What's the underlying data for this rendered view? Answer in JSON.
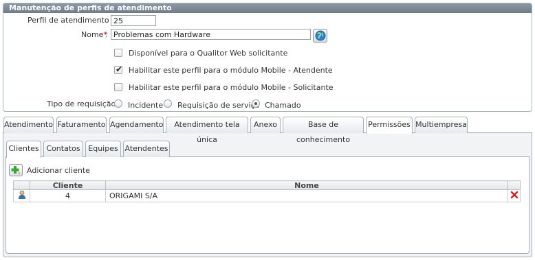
{
  "panel": {
    "title": "Manutenção de perfis de atendimento",
    "perfil_label": "Perfil de atendimento :",
    "perfil_value": "25",
    "nome_label": "Nome",
    "nome_required": "*",
    "nome_colon": ":",
    "nome_value": "Problemas com Hardware",
    "checkboxes": [
      {
        "label": "Disponível para o Qualitor Web solicitante",
        "checked": false
      },
      {
        "label": "Habilitar este perfil para o módulo Mobile - Atendente",
        "checked": true
      },
      {
        "label": "Habilitar este perfil para o módulo Mobile - Solicitante",
        "checked": false
      }
    ],
    "tipo_label": "Tipo de requisição :",
    "radios": [
      {
        "label": "Incidente",
        "selected": false
      },
      {
        "label": "Requisição de serviço",
        "selected": false
      },
      {
        "label": "Chamado",
        "selected": true
      }
    ]
  },
  "tabs": [
    "Atendimento",
    "Faturamento",
    "Agendamento",
    "Atendimento tela única",
    "Anexo",
    "Base de conhecimento",
    "Permissões",
    "Multiempresa"
  ],
  "active_tab": "Permissões",
  "subtabs": [
    "Clientes",
    "Contatos",
    "Equipes",
    "Atendentes"
  ],
  "active_subtab": "Clientes",
  "add_client_label": "Adicionar cliente",
  "table": {
    "headers": [
      "Cliente",
      "Nome"
    ],
    "rows": [
      {
        "cliente": "4",
        "nome": "ORIGAMI S/A"
      }
    ]
  },
  "colors": {
    "header_bg": "#7a8793",
    "delete_red": "#e02020",
    "globe_blue": "#2f7fd0",
    "add_green": "#3aa832"
  },
  "icons": {
    "globe": "globe-icon",
    "add": "add-client-icon",
    "user": "user-icon",
    "delete": "delete-icon"
  }
}
